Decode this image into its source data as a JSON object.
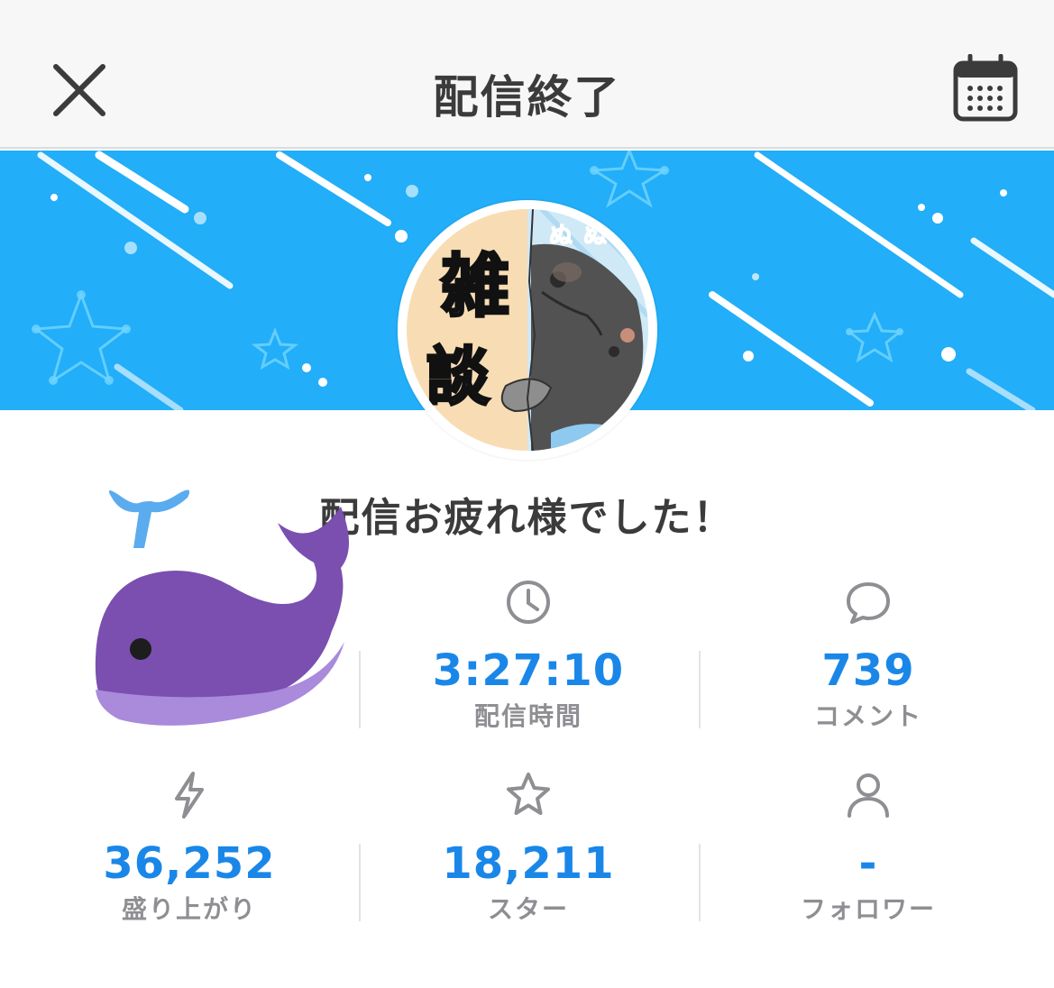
{
  "header": {
    "title": "配信終了",
    "close_icon": "close-icon",
    "calendar_icon": "calendar-icon"
  },
  "banner": {
    "background_color": "#22aef8",
    "avatar_text": [
      "雑",
      "談",
      "ぬ",
      "ぬ"
    ]
  },
  "message": "配信お疲れ様でした！",
  "stats": [
    {
      "id": "duration",
      "icon": "clock-icon",
      "value": "3:27:10",
      "label": "配信時間"
    },
    {
      "id": "comments",
      "icon": "speech-bubble-icon",
      "value": "739",
      "label": "コメント"
    },
    {
      "id": "excitement",
      "icon": "lightning-icon",
      "value": "36,252",
      "label": "盛り上がり"
    },
    {
      "id": "stars",
      "icon": "star-icon",
      "value": "18,211",
      "label": "スター"
    },
    {
      "id": "followers",
      "icon": "person-icon",
      "value": "-",
      "label": "フォロワー"
    }
  ],
  "colors": {
    "accent": "#1a87e8",
    "label": "#8e8e93",
    "title": "#3b3b3b",
    "whale": "#7a4fb0"
  }
}
